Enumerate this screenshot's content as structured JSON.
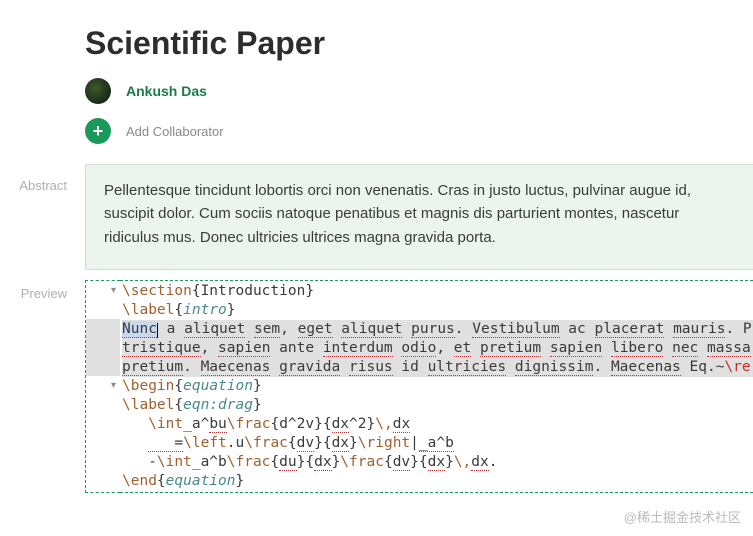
{
  "title": "Scientific Paper",
  "owner": "Ankush Das",
  "add_collaborator_label": "Add Collaborator",
  "sections": {
    "abstract_label": "Abstract",
    "preview_label": "Preview"
  },
  "abstract_text": "Pellentesque tincidunt lobortis orci non venenatis. Cras in justo luctus, pulvinar augue id, suscipit dolor. Cum sociis natoque penatibus et magnis dis parturient montes, nascetur ridiculus mus. Donec ultricies ultrices magna gravida porta.",
  "watermark": "@稀土掘金技术社区",
  "code_lines": [
    {
      "html": "<span class='tok-cmd'>\\section</span><span class='tok-brace'>{</span><span class='tok-text'>Introduction</span><span class='tok-brace'>}</span>",
      "fold": true,
      "active": false
    },
    {
      "html": "<span class='tok-cmd'>\\label</span><span class='tok-brace'>{</span><span class='tok-arg'>intro</span><span class='tok-brace'>}</span>",
      "fold": false,
      "active": false
    },
    {
      "html": "<span class='selword spell'>Nunc</span><span class='cursor'></span> a <span class='spell'>aliquet</span> <span class='spell'>sem</span>, <span class='spell'>eget</span> <span class='spell'>aliquet</span> <span class='spell'>purus</span>. <span class='spell'>Vestibulum</span> ac <span class='spell'>placerat</span> <span class='spell'>mauris</span>. P",
      "fold": false,
      "active": true
    },
    {
      "html": "<span class='spell'>tristique</span>, <span class='spell'>sapien</span> ante <span class='spell'>interdum</span> <span class='spell'>odio</span>, <span class='spell'>et</span> <span class='spell'>pretium</span> <span class='spell'>sapien</span> <span class='spell'>libero</span> <span class='spell'>nec</span> <span class='spell'>massa</span>",
      "fold": false,
      "active": true
    },
    {
      "html": "<span class='spell'>pretium</span>. <span class='spell'>Maecenas</span> <span class='spell'>gravida</span> <span class='spell'>risus</span> id <span class='spell'>ultricies</span> <span class='spell'>dignissim</span>. <span class='spell'>Maecenas</span> Eq.~<span class='tok-red'>\\re</span>",
      "fold": false,
      "active": true
    },
    {
      "html": "<span class='tok-cmd'>\\begin</span><span class='tok-brace'>{</span><span class='tok-arg'>equation</span><span class='tok-brace'>}</span>",
      "fold": true,
      "active": false
    },
    {
      "html": "<span class='tok-cmd'>\\label</span><span class='tok-brace'>{</span><span class='tok-arg'>eqn:drag</span><span class='tok-brace'>}</span>",
      "fold": false,
      "active": false
    },
    {
      "html": "   <span class='tok-cmd'>\\int</span><span class='tok-math'>_a^</span><span class='spell'>bu</span><span class='tok-cmd'>\\frac</span><span class='tok-brace'>{</span>d^2v<span class='tok-brace'>}{</span><span class='spell'>dx</span>^2<span class='tok-brace'>}</span><span class='tok-cmd'>\\,</span><span class='spell'>dx</span>",
      "fold": false,
      "active": false
    },
    {
      "html": "   <span class='spell'>&nbsp;&nbsp;&nbsp;=</span><span class='tok-cmd'>\\left</span>.u<span class='tok-cmd'>\\frac</span><span class='tok-brace'>{</span><span class='spell'>dv</span><span class='tok-brace'>}{</span><span class='spell'>dx</span><span class='tok-brace'>}</span><span class='tok-cmd'>\\right</span>|<span class='spell'>_a^b</span>",
      "fold": false,
      "active": false
    },
    {
      "html": "   -<span class='tok-cmd'>\\int</span>_a^b<span class='tok-cmd'>\\frac</span><span class='tok-brace'>{</span><span class='spell'>du</span><span class='tok-brace'>}{</span><span class='spell'>dx</span><span class='tok-brace'>}</span><span class='tok-cmd'>\\frac</span><span class='tok-brace'>{</span><span class='spell'>dv</span><span class='tok-brace'>}{</span><span class='spell'>dx</span><span class='tok-brace'>}</span><span class='tok-cmd'>\\,</span><span class='spell'>dx</span>.",
      "fold": false,
      "active": false
    },
    {
      "html": "<span class='tok-cmd'>\\end</span><span class='tok-brace'>{</span><span class='tok-arg'>equation</span><span class='tok-brace'>}</span>",
      "fold": false,
      "active": false
    }
  ]
}
